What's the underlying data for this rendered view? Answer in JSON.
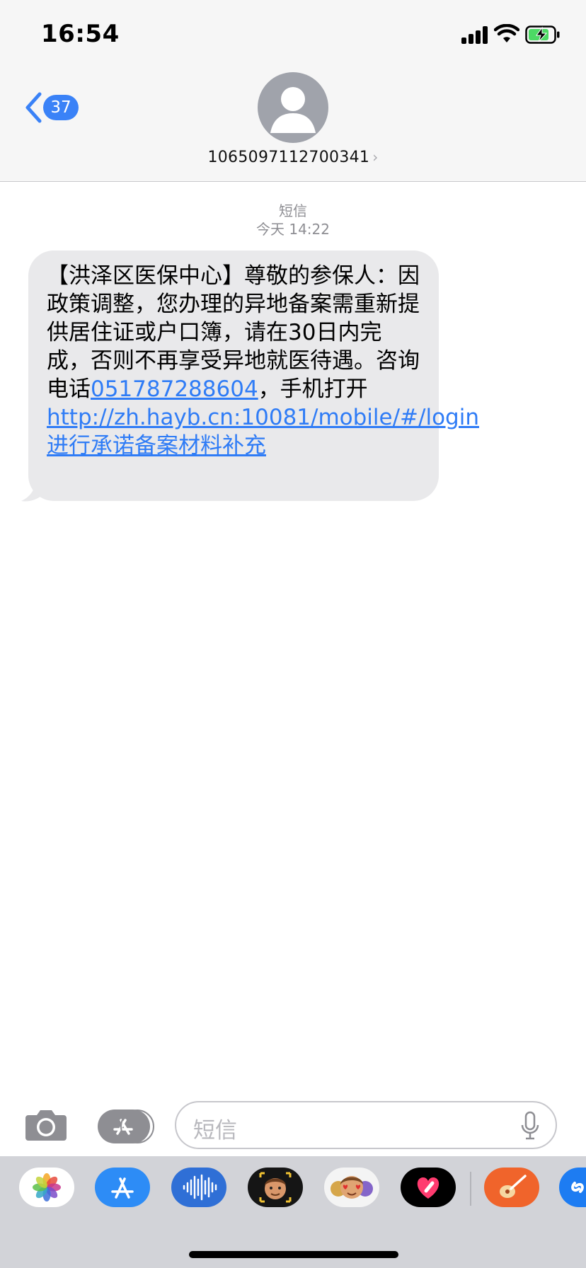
{
  "status_bar": {
    "time": "16:54"
  },
  "nav": {
    "back_badge": "37",
    "contact_number": "1065097112700341"
  },
  "thread": {
    "service_label": "短信",
    "timestamp": "今天 14:22"
  },
  "message": {
    "text_before_phone": "【洪泽区医保中心】尊敬的参保人：因政策调整，您办理的异地备案需重新提供居住证或户口簿，请在30日内完成，否则不再享受异地就医待遇。咨询电话",
    "phone": "051787288604",
    "text_middle": "，手机打开 ",
    "url": "http://zh.hayb.cn:10081/mobile/#/login",
    "text_after_url": "进行承诺备案材料补充"
  },
  "input": {
    "placeholder": "短信"
  },
  "drawer_apps": [
    {
      "icon": "photos-icon"
    },
    {
      "icon": "app-store-icon"
    },
    {
      "icon": "audio-message-icon"
    },
    {
      "icon": "memoji-icon"
    },
    {
      "icon": "memoji-stickers-icon"
    },
    {
      "icon": "digital-touch-icon"
    },
    {
      "icon": "garageband-icon"
    },
    {
      "icon": "shazam-icon"
    }
  ],
  "colors": {
    "accent": "#3a82f7",
    "bubble": "#e9e9eb",
    "link": "#2f7cf6",
    "header_bg": "#f6f6f6",
    "drawer_bg": "#d2d3d8"
  }
}
